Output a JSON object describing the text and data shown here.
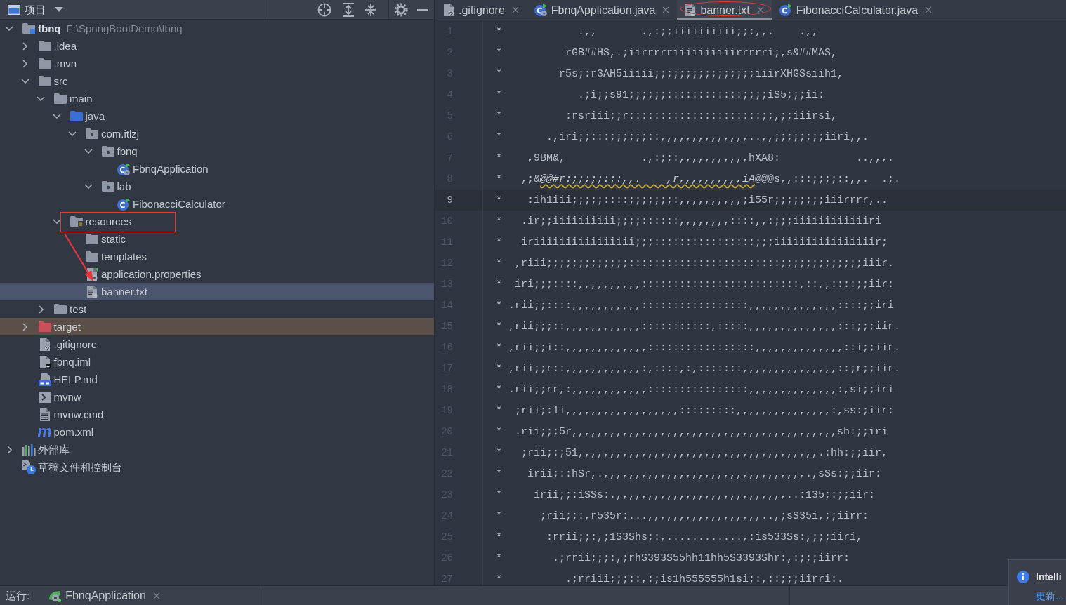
{
  "project_panel": {
    "title": "项目",
    "selection_arrow": true,
    "tree": [
      {
        "name": "fbnq",
        "path": "F:\\SpringBootDemo\\fbnq",
        "kind": "module",
        "expanded": true,
        "selected": false,
        "boxed": false,
        "children": [
          {
            "name": ".idea",
            "kind": "folder",
            "expanded": false,
            "selected": false,
            "boxed": false
          },
          {
            "name": ".mvn",
            "kind": "folder",
            "expanded": false,
            "selected": false,
            "boxed": false
          },
          {
            "name": "src",
            "kind": "folder",
            "expanded": true,
            "selected": false,
            "boxed": false,
            "children": [
              {
                "name": "main",
                "kind": "folder",
                "expanded": true,
                "selected": false,
                "boxed": false,
                "children": [
                  {
                    "name": "java",
                    "kind": "source-folder",
                    "expanded": true,
                    "selected": false,
                    "boxed": false,
                    "children": [
                      {
                        "name": "com.itlzj",
                        "kind": "package",
                        "expanded": true,
                        "selected": false,
                        "boxed": false,
                        "children": [
                          {
                            "name": "fbnq",
                            "kind": "package",
                            "expanded": true,
                            "selected": false,
                            "boxed": false,
                            "children": [
                              {
                                "name": "FbnqApplication",
                                "kind": "spring-class",
                                "selected": false,
                                "boxed": false
                              }
                            ]
                          },
                          {
                            "name": "lab",
                            "kind": "package",
                            "expanded": true,
                            "selected": false,
                            "boxed": false,
                            "children": [
                              {
                                "name": "FibonacciCalculator",
                                "kind": "class",
                                "selected": false,
                                "boxed": false
                              }
                            ]
                          }
                        ]
                      }
                    ]
                  },
                  {
                    "name": "resources",
                    "kind": "resources-folder",
                    "expanded": true,
                    "selected": false,
                    "boxed": true,
                    "children": [
                      {
                        "name": "static",
                        "kind": "folder",
                        "selected": false,
                        "boxed": false
                      },
                      {
                        "name": "templates",
                        "kind": "folder",
                        "selected": false,
                        "boxed": false
                      },
                      {
                        "name": "application.properties",
                        "kind": "properties",
                        "selected": false,
                        "boxed": false
                      },
                      {
                        "name": "banner.txt",
                        "kind": "text",
                        "selected": true,
                        "boxed": false
                      }
                    ]
                  }
                ]
              },
              {
                "name": "test",
                "kind": "folder",
                "expanded": false,
                "selected": false,
                "boxed": false
              }
            ]
          },
          {
            "name": "target",
            "kind": "excluded-folder",
            "expanded": false,
            "selected": false,
            "boxed": false
          },
          {
            "name": ".gitignore",
            "kind": "gitignore",
            "selected": false,
            "boxed": false
          },
          {
            "name": "fbnq.iml",
            "kind": "iml",
            "selected": false,
            "boxed": false
          },
          {
            "name": "HELP.md",
            "kind": "markdown",
            "selected": false,
            "boxed": false
          },
          {
            "name": "mvnw",
            "kind": "shell",
            "selected": false,
            "boxed": false
          },
          {
            "name": "mvnw.cmd",
            "kind": "cmd",
            "selected": false,
            "boxed": false
          },
          {
            "name": "pom.xml",
            "kind": "maven",
            "glyph": "m",
            "selected": false,
            "boxed": false
          }
        ]
      },
      {
        "name": "外部库",
        "kind": "libraries",
        "expanded": false,
        "selected": false,
        "boxed": false
      },
      {
        "name": "草稿文件和控制台",
        "kind": "scratches",
        "selected": false,
        "boxed": false
      }
    ]
  },
  "editor": {
    "tabs": [
      {
        "label": ".gitignore",
        "kind": "gitignore",
        "selected": false,
        "circled": false
      },
      {
        "label": "FbnqApplication.java",
        "kind": "spring-class",
        "selected": false,
        "circled": false
      },
      {
        "label": "banner.txt",
        "kind": "text",
        "selected": true,
        "circled": true
      },
      {
        "label": "FibonacciCalculator.java",
        "kind": "class",
        "selected": false,
        "circled": false
      }
    ],
    "lines": [
      {
        "number": "1",
        "current": false,
        "text": "*            .,,       .,:;;iiiiiiiiii;;:,,.    .,,"
      },
      {
        "number": "2",
        "current": false,
        "text": "*          rGB##HS,.;iirrrrriiiiiiiiiirrrrri;,s&##MAS,"
      },
      {
        "number": "3",
        "current": false,
        "text": "*         r5s;:r3AH5iiiii;;;;;;;;;;;;;;;;iiirXHGSsiih1,"
      },
      {
        "number": "4",
        "current": false,
        "text": "*            .;i;;s91;;;;;;::::::::::::;;;;iS5;;;ii:"
      },
      {
        "number": "5",
        "current": false,
        "text": "*          :rsriii;;r:::::::::::::::::::::;;,;;iiirsi,"
      },
      {
        "number": "6",
        "current": false,
        "text": "*       .,iri;;:::;;;;;;::,,,,,,,,,,,,,,..,,;;;;;;;;iiri,,."
      },
      {
        "number": "7",
        "current": false,
        "text": "*    ,9BM&,            .,:;;:,,,,,,,,,,,hXA8:            ..,,,."
      },
      {
        "number": "8",
        "current": false,
        "segments": [
          {
            "text": "*   ,;&",
            "typo": false
          },
          {
            "text": "@@#r:;;;;;:::,,.    ,r,,,,,,,,,,iA",
            "typo": true
          },
          {
            "text": "@@@s,,:::;;;;::,,.  .;.",
            "typo": false
          }
        ]
      },
      {
        "number": "9",
        "current": true,
        "text": "*    :ih1iii;;;;;::::;;;;;;;:,,,,,,,,,,;i55r;;;;;;;;iiirrrr,.."
      },
      {
        "number": "10",
        "current": false,
        "text": "*   .ir;;iiiiiiiiii;;;;::::::,,,,,,,,::::,,:;;;iiiiiiiiiiiiri"
      },
      {
        "number": "11",
        "current": false,
        "text": "*   iriiiiiiiiiiiiiiii;;;::::::::::::::::;;;iiiiiiiiiiiiiiiir;"
      },
      {
        "number": "12",
        "current": false,
        "text": "*  ,riii;;;;;;;;;;;;;::::::::::::::::::::::::;;;;;;;;;;;;;iiir."
      },
      {
        "number": "13",
        "current": false,
        "text": "*  iri;;;::::,,,,,,,,,,:::::::::::::::::::::::::,::,,::::;;iir:"
      },
      {
        "number": "14",
        "current": false,
        "text": "* .rii;;::::,,,,,,,,,,,:::::::::::::::::,,,,,,,,,,,,,,::::;;iri"
      },
      {
        "number": "15",
        "current": false,
        "text": "* ,rii;;;::,,,,,,,,,,,,:::::::::::,:::::,,,,,,,,,,,,,,:::;;;iir."
      },
      {
        "number": "16",
        "current": false,
        "text": "* ,rii;;i::,,,,,,,,,,,,,:::::::::::::::::,,,,,,,,,,,,,,::i;;iir."
      },
      {
        "number": "17",
        "current": false,
        "text": "* ,rii;;r::,,,,,,,,,,,,:,::::,:,:::::::,,,,,,,,,,,,,,,::;r;;iir."
      },
      {
        "number": "18",
        "current": false,
        "text": "* .rii;;rr,:,,,,,,,,,,,,::::::::::::::::,,,,,,,,,,,,,,:,si;;iri"
      },
      {
        "number": "19",
        "current": false,
        "text": "*  ;rii;:1i,,,,,,,,,,,,,,,,,,:::::::::,,,,,,,,,,,,,,,:,ss:;iir:"
      },
      {
        "number": "20",
        "current": false,
        "text": "*  .rii;;;5r,,,,,,,,,,,,,,,,,,,,,,,,,,,,,,,,,,,,,,,,,,sh:;;iri"
      },
      {
        "number": "21",
        "current": false,
        "text": "*   ;rii;:;51,,,,,,,,,,,,,,,,,,,,,,,,,,,,,,,,,,,,,,.:hh:;;iir,"
      },
      {
        "number": "22",
        "current": false,
        "text": "*    irii;::hSr,.,,,,,,,,,,,,,,,,,,,,,,,,,,,,,,,,.,sSs:;;iir:"
      },
      {
        "number": "23",
        "current": false,
        "text": "*     irii;;:iSSs:.,,,,,,,,,,,,,,,,,,,,,,,,,,,..:135;:;;iir:"
      },
      {
        "number": "24",
        "current": false,
        "text": "*      ;rii;;:,r535r:...,,,,,,,,,,,,,,,,,,..,;sS35i,;;iirr:"
      },
      {
        "number": "25",
        "current": false,
        "text": "*       :rrii;;:,;1S3Shs;:,............,:is533Ss:,;;;iiri,"
      },
      {
        "number": "26",
        "current": false,
        "text": "*        .;rrii;;;:,;rhS393S55hh11hh5S3393Shr:,:;;;iirr:"
      },
      {
        "number": "27",
        "current": false,
        "text": "*          .;rriii;;;::,:;is1h555555h1si;:,::;;;iirri:."
      }
    ]
  },
  "run_bar": {
    "label": "运行:",
    "tab": {
      "label": "FbnqApplication"
    }
  },
  "notification": {
    "title": "Intelli",
    "link": "更新..."
  }
}
